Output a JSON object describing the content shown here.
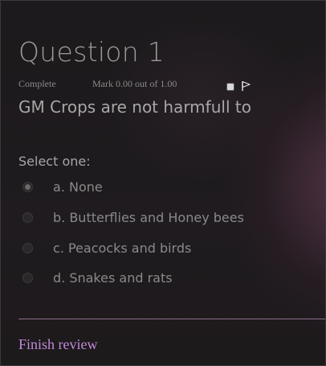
{
  "question": {
    "title": "Question 1",
    "state": "Complete",
    "mark": "Mark 0.00 out of 1.00",
    "text": "GM Crops are not harmfull to"
  },
  "prompt": "Select one:",
  "answers": [
    {
      "label": "a. None",
      "selected": true
    },
    {
      "label": "b. Butterflies and Honey bees",
      "selected": false
    },
    {
      "label": "c. Peacocks and birds",
      "selected": false
    },
    {
      "label": "d. Snakes and rats",
      "selected": false
    }
  ],
  "footer": {
    "finish_review": "Finish review"
  },
  "colors": {
    "accent_link": "#c08ad8",
    "divider": "#8c6f8a",
    "text_primary": "#a8a8a8",
    "text_muted": "#8a8a8a"
  }
}
